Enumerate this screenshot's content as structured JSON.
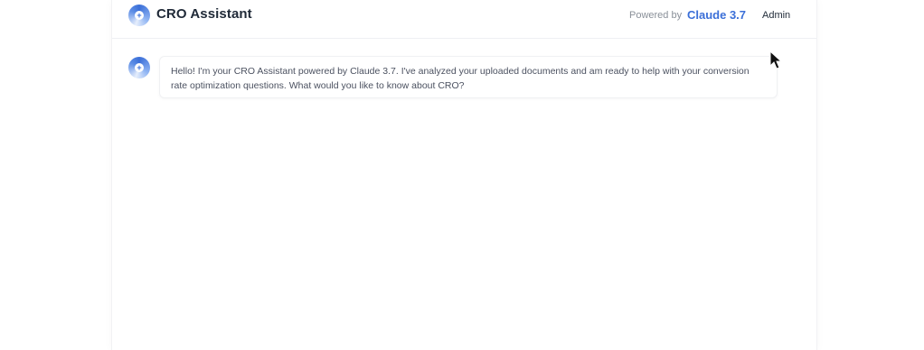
{
  "header": {
    "title": "CRO Assistant",
    "powered_by_label": "Powered by",
    "model_name": "Claude 3.7",
    "admin_label": "Admin",
    "logo_icon": "logo-icon"
  },
  "chat": {
    "messages": [
      {
        "role": "assistant",
        "avatar_icon": "assistant-avatar-icon",
        "text": "Hello! I'm your CRO Assistant powered by Claude 3.7. I've analyzed your uploaded documents and am ready to help with your conversion rate optimization questions. What would you like to know about CRO?"
      }
    ]
  },
  "colors": {
    "accent": "#3b6fd8",
    "title_text": "#1f2937",
    "muted_text": "#8a9099",
    "body_text": "#4b5160"
  }
}
